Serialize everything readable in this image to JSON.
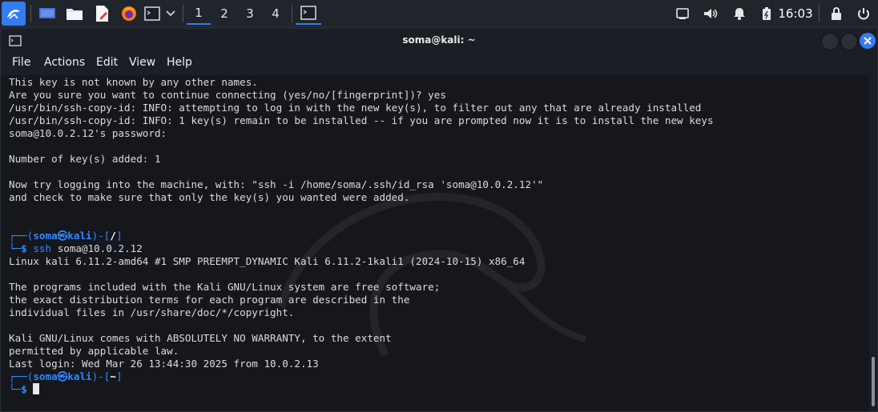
{
  "panel": {
    "workspaces": [
      "1",
      "2",
      "3",
      "4"
    ],
    "active_workspace": "1",
    "clock": "16:03",
    "icons": [
      "kali-menu-icon",
      "desktop-icon",
      "files-icon",
      "text-editor-icon",
      "firefox-icon",
      "terminal-icon",
      "chevron-down-icon",
      "terminal-task-icon",
      "network-icon",
      "volume-icon",
      "notifications-icon",
      "battery-icon",
      "lock-icon",
      "power-icon"
    ]
  },
  "window": {
    "title": "soma@kali: ~",
    "menu": [
      "File",
      "Actions",
      "Edit",
      "View",
      "Help"
    ]
  },
  "terminal": {
    "lines": [
      "This key is not known by any other names.",
      "Are you sure you want to continue connecting (yes/no/[fingerprint])? yes",
      "/usr/bin/ssh-copy-id: INFO: attempting to log in with the new key(s), to filter out any that are already installed",
      "/usr/bin/ssh-copy-id: INFO: 1 key(s) remain to be installed -- if you are prompted now it is to install the new keys",
      "soma@10.0.2.12's password:",
      "",
      "Number of key(s) added: 1",
      "",
      "Now try logging into the machine, with: \"ssh -i /home/soma/.ssh/id_rsa 'soma@10.0.2.12'\"",
      "and check to make sure that only the key(s) you wanted were added."
    ],
    "prompt1": {
      "user": "soma",
      "host": "kali",
      "dir": "/",
      "cmd": "ssh",
      "arg": "soma@10.0.2.12"
    },
    "lines2": [
      "Linux kali 6.11.2-amd64 #1 SMP PREEMPT_DYNAMIC Kali 6.11.2-1kali1 (2024-10-15) x86_64",
      "",
      "The programs included with the Kali GNU/Linux system are free software;",
      "the exact distribution terms for each program are described in the",
      "individual files in /usr/share/doc/*/copyright.",
      "",
      "Kali GNU/Linux comes with ABSOLUTELY NO WARRANTY, to the extent",
      "permitted by applicable law.",
      "Last login: Wed Mar 26 13:44:30 2025 from 10.0.2.13"
    ],
    "prompt2": {
      "user": "soma",
      "host": "kali",
      "dir": "~"
    }
  },
  "colors": {
    "accent": "#367bf0",
    "prompt": "#2f8bff",
    "close": "#367bf0"
  }
}
